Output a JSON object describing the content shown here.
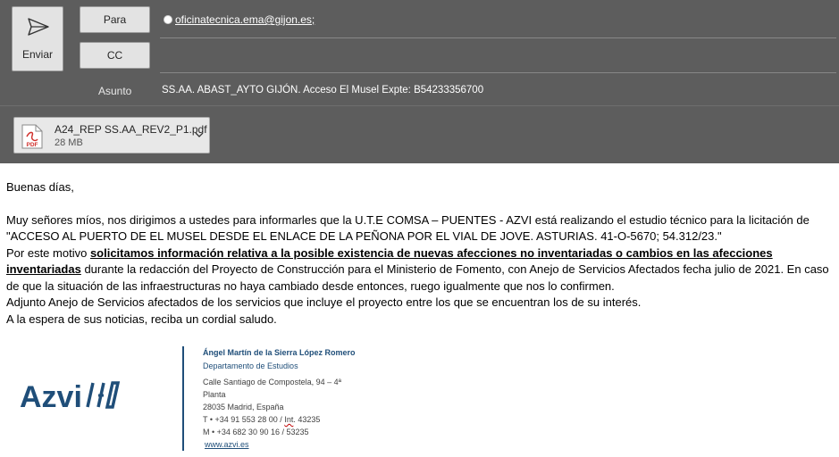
{
  "header": {
    "send_label": "Enviar",
    "to_label": "Para",
    "cc_label": "CC",
    "to_value": "oficinatecnica.ema@gijon.es;",
    "subject_label": "Asunto",
    "subject_value": "SS.AA. ABAST_AYTO GIJÓN. Acceso El Musel Expte: B54233356700"
  },
  "attachment": {
    "icon_label": "PDF",
    "name": "A24_REP SS.AA_REV2_P1.pdf",
    "size": "28 MB"
  },
  "body": {
    "greeting": "Buenas días,",
    "para1": "Muy señores míos, nos dirigimos a ustedes para informarles que la U.T.E COMSA – PUENTES - AZVI está realizando el estudio técnico para la licitación de \"ACCESO AL PUERTO DE EL MUSEL DESDE EL ENLACE  DE LA PEÑONA POR EL VIAL DE JOVE. ASTURIAS. 41-O-5670; 54.312/23.\"",
    "para2_pre": "Por este motivo ",
    "para2_bold": "solicitamos información relativa a la posible existencia de nuevas afecciones no inventariadas o cambios en las afecciones inventariadas",
    "para2_post": " durante la redacción del Proyecto de Construcción para el Ministerio de Fomento, con Anejo de Servicios Afectados fecha julio de 2021. En caso de que la situación de las infraestructuras no haya cambiado desde entonces, ruego igualmente que nos lo confirmen.",
    "para3": "Adjunto Anejo de Servicios afectados de los servicios que incluye el proyecto entre los que se encuentran los de su interés.",
    "closing": "A la espera de sus noticias, reciba un cordial saludo."
  },
  "signature": {
    "logo_text": "Azvi",
    "name": "Ángel Martín de la Sierra López Romero",
    "department": "Departamento de Estudios",
    "address1": "Calle Santiago de Compostela, 94 – 4ª",
    "address2": "Planta",
    "address3": "28035 Madrid, España",
    "phone_pre": "T •  +34 91 553 28 00 / ",
    "phone_int": "Int",
    "phone_post": ". 43235",
    "mobile": "M •  +34 682 30 90 16 / 53235",
    "website": "www.azvi.es"
  },
  "colors": {
    "header_bg": "#5d5d5d",
    "signature_blue": "#1f4e79",
    "pdf_red": "#d0312d"
  }
}
